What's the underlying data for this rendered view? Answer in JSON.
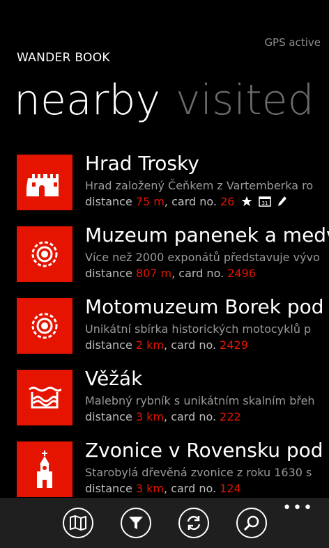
{
  "status": {
    "gps": "GPS active"
  },
  "app": {
    "title": "WANDER BOOK"
  },
  "pivot": {
    "tabs": [
      {
        "label": "nearby"
      },
      {
        "label": "visited"
      }
    ]
  },
  "labels": {
    "distance": "distance",
    "card": ", card no."
  },
  "items": [
    {
      "name": "Hrad Trosky",
      "desc": "Hrad založený Čeňkem z Vartemberka ro",
      "distance": "75 m",
      "card": "26",
      "icon": "castle-icon"
    },
    {
      "name": "Muzeum panenek a medv",
      "desc": "Více než 2000 exponátů představuje vývo",
      "distance": "807 m",
      "card": "2496",
      "icon": "museum-icon"
    },
    {
      "name": "Motomuzeum Borek pod T",
      "desc": "Unikátní sbírka historických motocyklů p",
      "distance": "2 km",
      "card": "2429",
      "icon": "museum-icon"
    },
    {
      "name": "Věžák",
      "desc": "Malebný rybník s unikátním skalním břeh",
      "distance": "3 km",
      "card": "222",
      "icon": "pond-icon"
    },
    {
      "name": "Zvonice v Rovensku pod T",
      "desc": "Starobylá dřevěná zvonice z roku 1630 s",
      "distance": "3 km",
      "card": "124",
      "icon": "bell-tower-icon"
    }
  ],
  "appbar": {
    "buttons": [
      "map-icon",
      "filter-icon",
      "refresh-icon",
      "search-icon"
    ],
    "more": "•••"
  },
  "colors": {
    "accent": "#e51400",
    "background": "#000000",
    "appbar": "#1f1f1f"
  }
}
